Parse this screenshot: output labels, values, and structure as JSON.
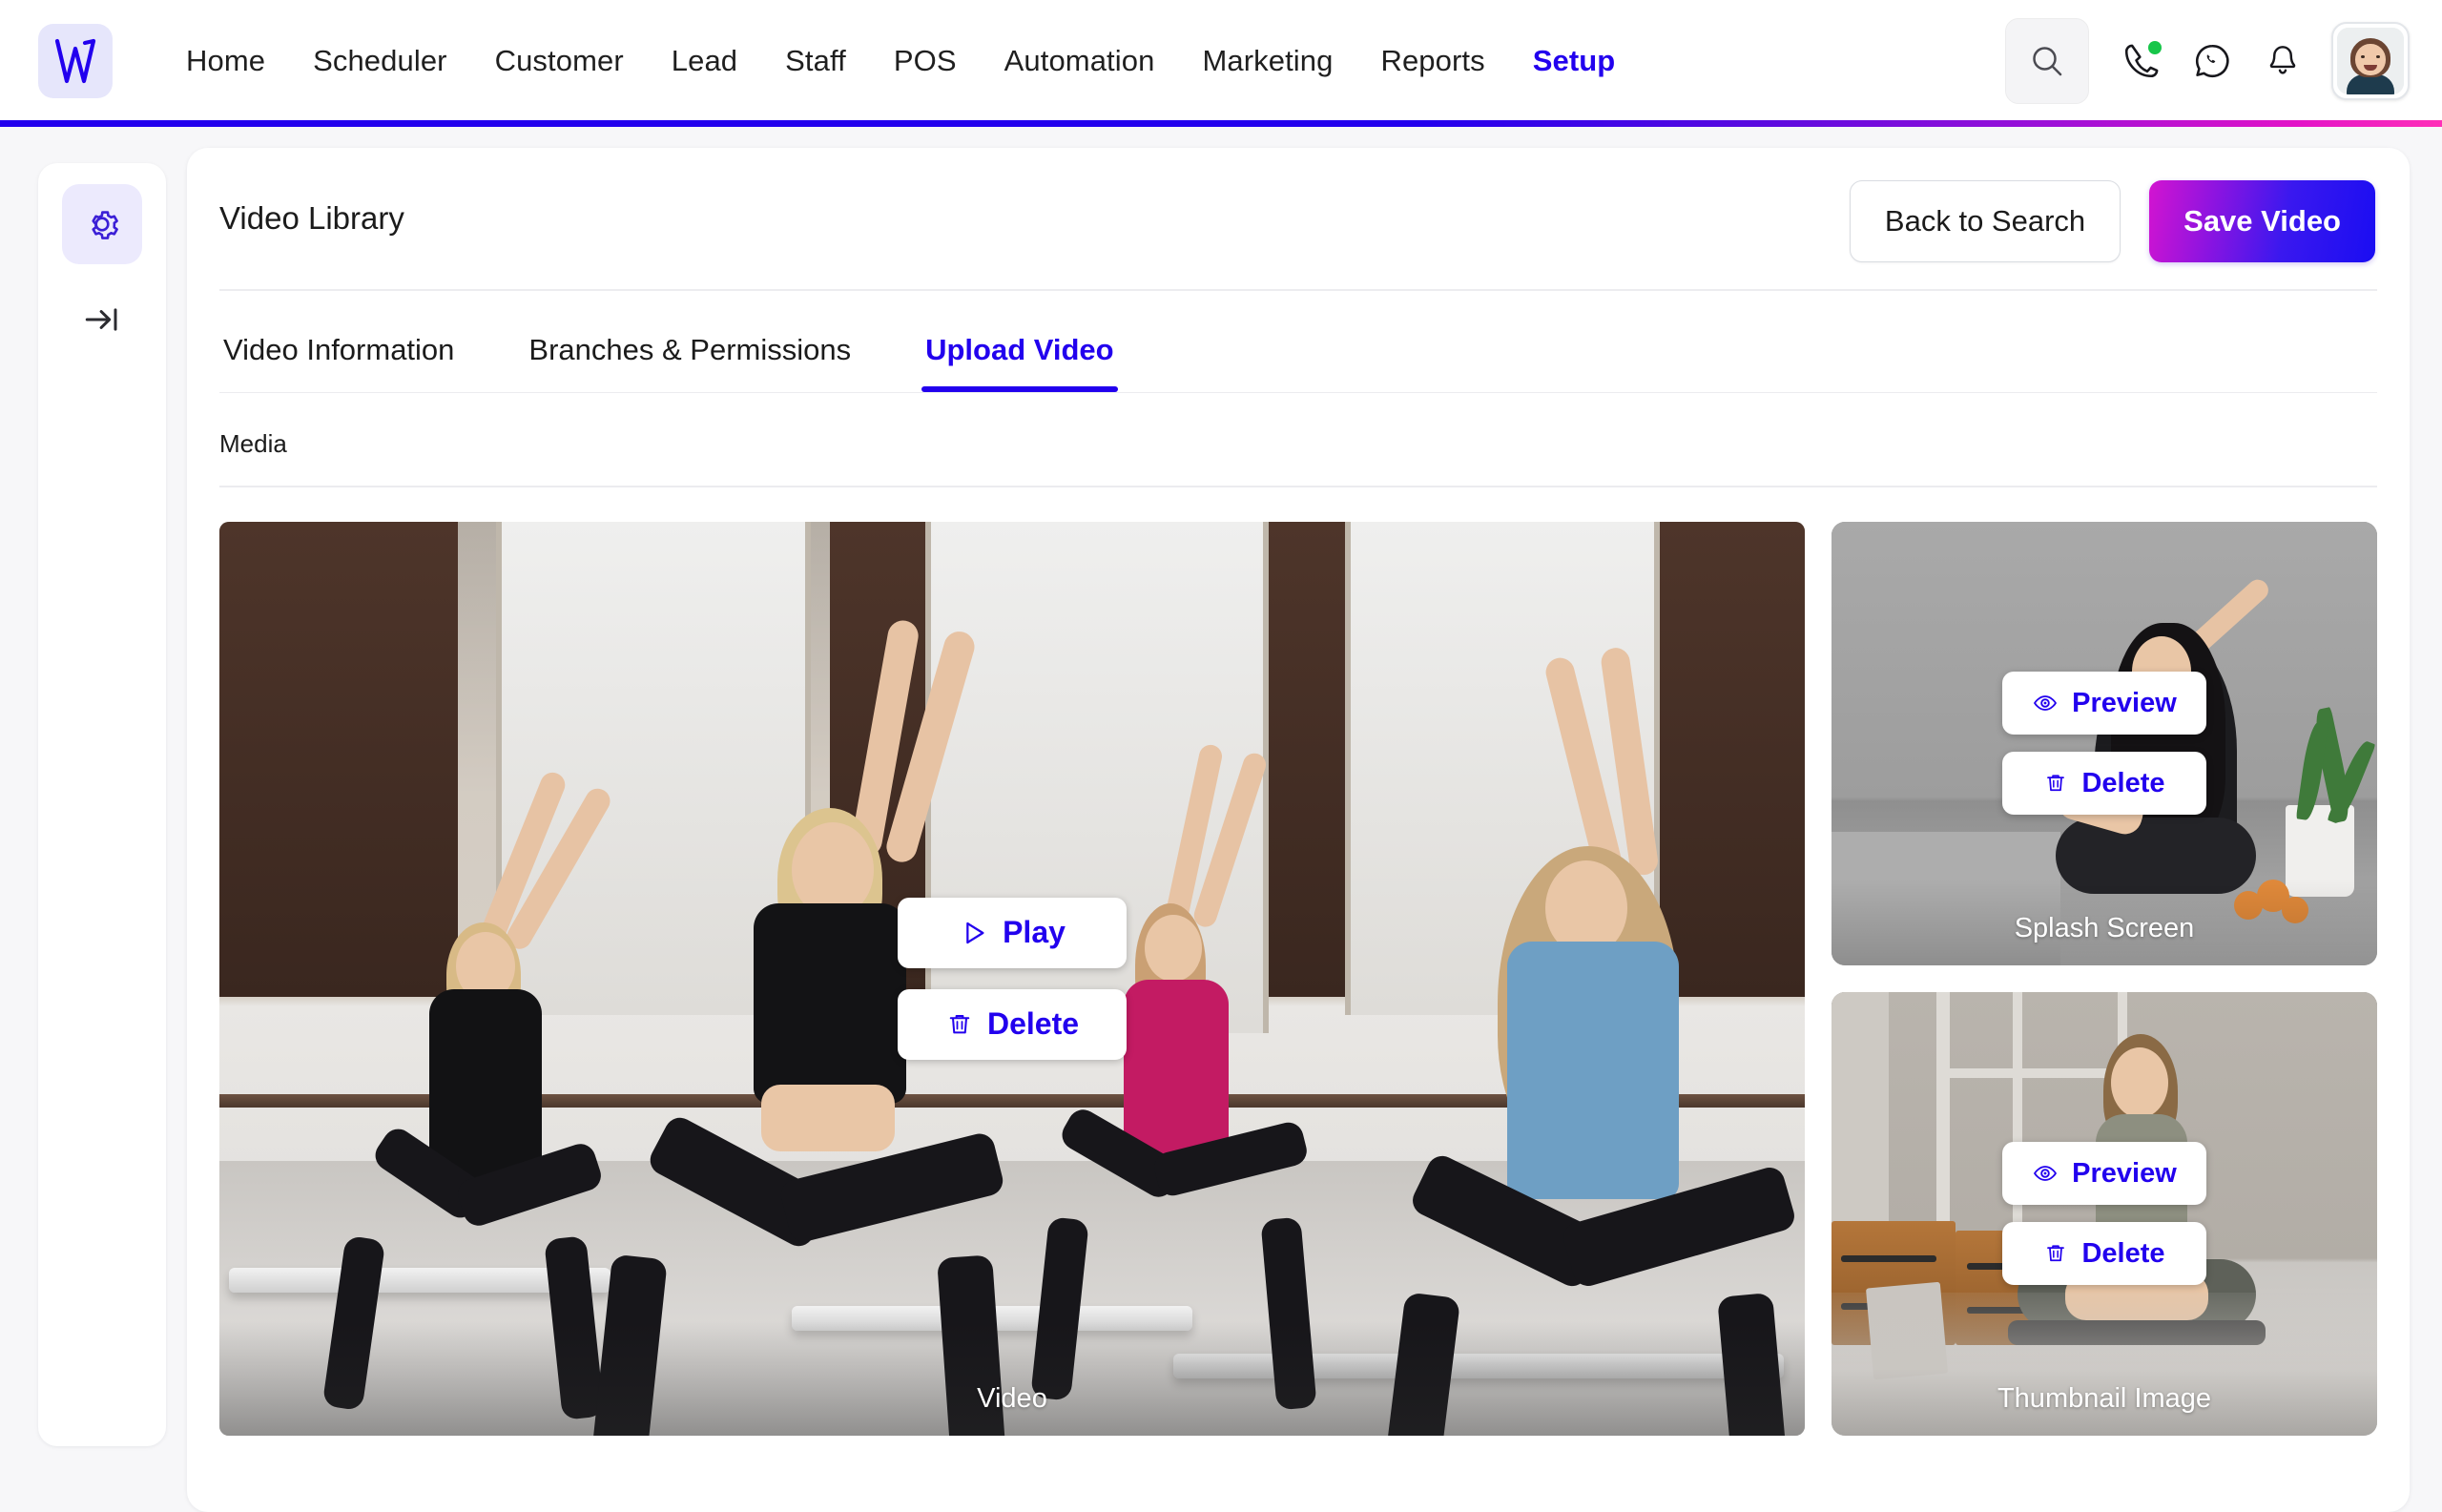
{
  "topnav": {
    "logo_icon": "w-logo-icon",
    "items": [
      {
        "label": "Home",
        "active": false
      },
      {
        "label": "Scheduler",
        "active": false
      },
      {
        "label": "Customer",
        "active": false
      },
      {
        "label": "Lead",
        "active": false
      },
      {
        "label": "Staff",
        "active": false
      },
      {
        "label": "POS",
        "active": false
      },
      {
        "label": "Automation",
        "active": false
      },
      {
        "label": "Marketing",
        "active": false
      },
      {
        "label": "Reports",
        "active": false
      },
      {
        "label": "Setup",
        "active": true
      }
    ],
    "actions": {
      "search_icon": "search-icon",
      "call_icon": "phone-call-icon",
      "whatsapp_icon": "whatsapp-icon",
      "bell_icon": "notification-bell-icon",
      "avatar": "user-avatar"
    },
    "accent_color": "#2200ee",
    "gradient_from": "#2200ee",
    "gradient_to": "#ff2fb8",
    "online_dot_color": "#17c64a"
  },
  "rail": {
    "items": [
      {
        "icon": "gear-icon",
        "selected": true
      },
      {
        "icon": "expand-panel-icon",
        "selected": false
      }
    ]
  },
  "card": {
    "title": "Video Library",
    "back_button": "Back to Search",
    "save_button": "Save Video",
    "tabs": [
      {
        "label": "Video Information",
        "active": false
      },
      {
        "label": "Branches & Permissions",
        "active": false
      },
      {
        "label": "Upload Video",
        "active": true
      }
    ],
    "section_label": "Media"
  },
  "media": {
    "video": {
      "caption": "Video",
      "buttons": [
        {
          "label": "Play",
          "icon": "play-icon"
        },
        {
          "label": "Delete",
          "icon": "trash-icon"
        }
      ]
    },
    "splash": {
      "caption": "Splash Screen",
      "buttons": [
        {
          "label": "Preview",
          "icon": "eye-icon"
        },
        {
          "label": "Delete",
          "icon": "trash-icon"
        }
      ]
    },
    "thumbnail": {
      "caption": "Thumbnail Image",
      "buttons": [
        {
          "label": "Preview",
          "icon": "eye-icon"
        },
        {
          "label": "Delete",
          "icon": "trash-icon"
        }
      ]
    }
  }
}
